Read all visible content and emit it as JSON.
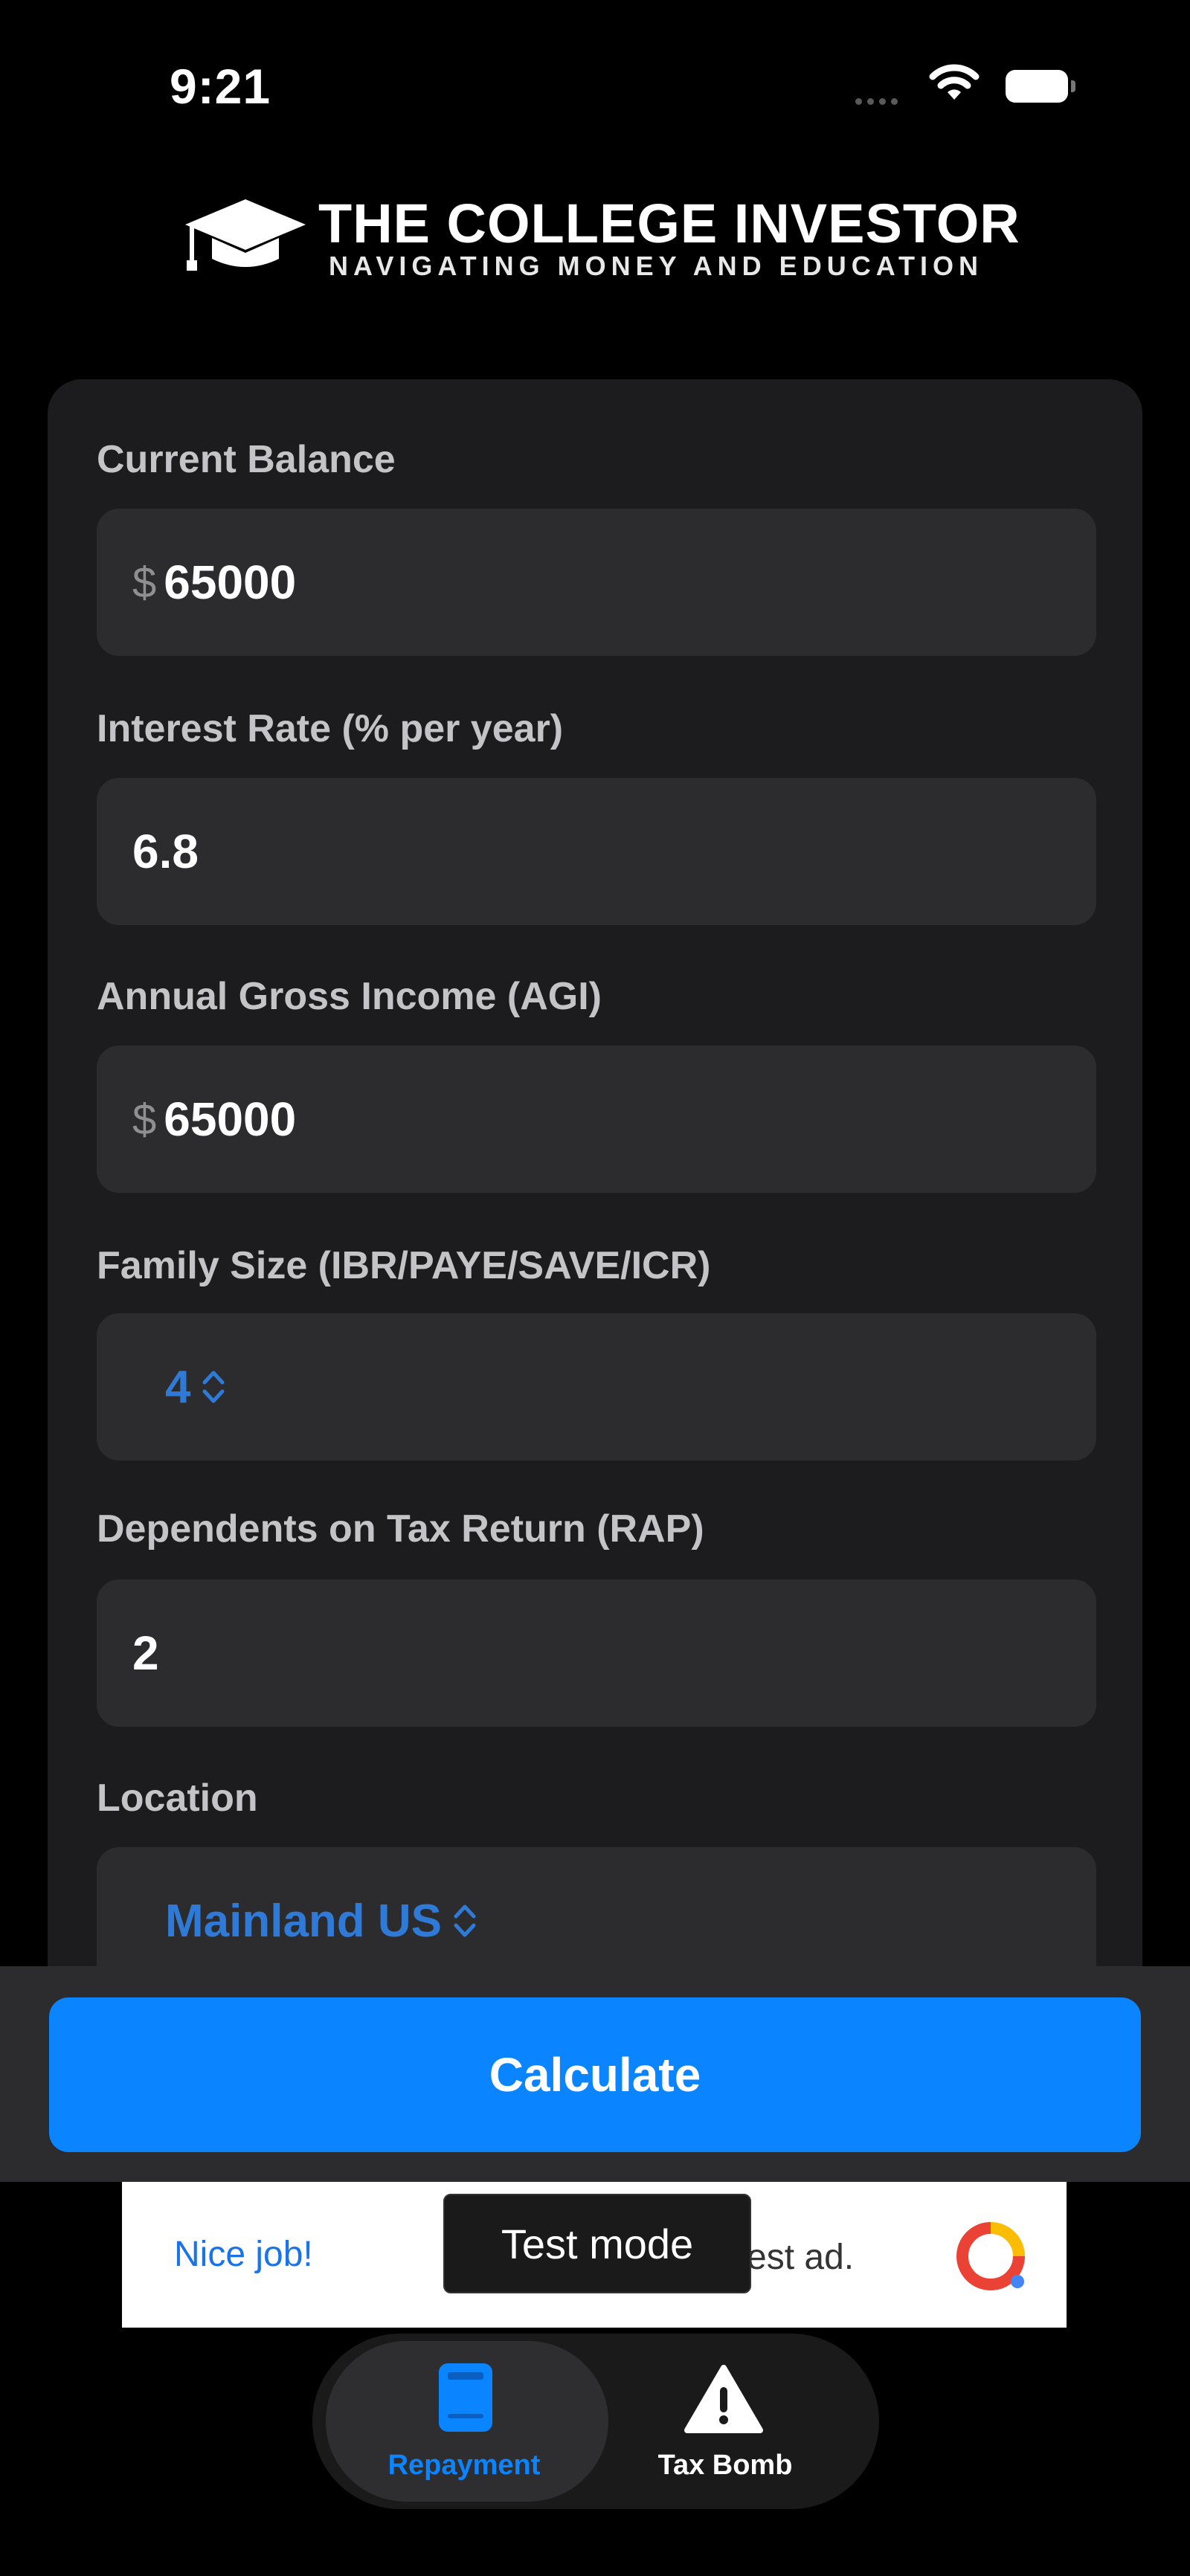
{
  "status_bar": {
    "time": "9:21"
  },
  "header": {
    "logo_title": "THE COLLEGE INVESTOR",
    "logo_tagline": "NAVIGATING MONEY AND EDUCATION"
  },
  "form": {
    "current_balance": {
      "label": "Current Balance",
      "prefix": "$",
      "value": "65000"
    },
    "interest_rate": {
      "label": "Interest Rate (% per year)",
      "value": "6.8"
    },
    "annual_income": {
      "label": "Annual Gross Income (AGI)",
      "prefix": "$",
      "value": "65000"
    },
    "family_size": {
      "label": "Family Size (IBR/PAYE/SAVE/ICR)",
      "value": "4"
    },
    "dependents": {
      "label": "Dependents on Tax Return (RAP)",
      "value": "2"
    },
    "location": {
      "label": "Location",
      "value": "Mainland US"
    }
  },
  "actions": {
    "calculate_label": "Calculate"
  },
  "ad": {
    "left_text": "Nice job!",
    "right_text": "est ad.",
    "toast": "Test mode"
  },
  "tabs": [
    {
      "label": "Repayment",
      "icon": "book-icon",
      "active": true
    },
    {
      "label": "Tax Bomb",
      "icon": "warning-icon",
      "active": false
    }
  ],
  "colors": {
    "accent": "#0a84ff",
    "picker_text": "#2f7ad6",
    "card_bg": "#1c1c1e",
    "field_bg": "#2c2c2e"
  }
}
